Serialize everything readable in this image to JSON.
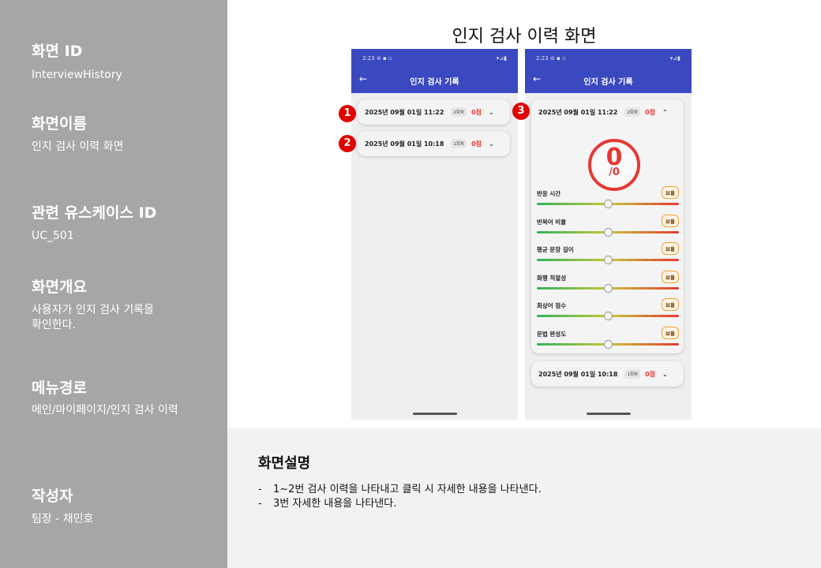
{
  "sidebar": {
    "screen_id_title": "화면 ID",
    "screen_id": "InterviewHistory",
    "screen_name_title": "화면이름",
    "screen_name": "인지 검사 이력 화면",
    "usecase_title": "관련 유스케이스 ID",
    "usecase_id": "UC_501",
    "overview_title": "화면개요",
    "overview_line1": "사용자가  인지 검사 기록을",
    "overview_line2": "확인한다.",
    "menu_title": "메뉴경로",
    "menu_path": "메인/마이페이지/인지 검사 이력",
    "author_title": "작성자",
    "author": "팀장 - 채민호"
  },
  "main_title": "인지 검사 이력 화면",
  "phone": {
    "status_time": "2:23",
    "status_icons_left": "⊘ ▪ ▫",
    "status_icons_right": "▾⊿▮",
    "back_icon": "←",
    "app_title": "인지 검사 기록"
  },
  "records": [
    {
      "date": "2025년 09월 01일 11:22",
      "count": "2회차",
      "score": "0점",
      "chevron": "⌄"
    },
    {
      "date": "2025년 09월 01일 10:18",
      "count": "1회차",
      "score": "0점",
      "chevron": "⌄"
    }
  ],
  "expanded": {
    "chevron_up": "⌃",
    "score_big": "0",
    "score_small": "/0",
    "metrics": [
      {
        "label": "반응 시간",
        "tag": "보통",
        "level": 0.5
      },
      {
        "label": "반복어 비율",
        "tag": "보통",
        "level": 0.5
      },
      {
        "label": "평균 문장 길이",
        "tag": "보통",
        "level": 0.5
      },
      {
        "label": "화행 적절성",
        "tag": "보통",
        "level": 0.5
      },
      {
        "label": "회상어 점수",
        "tag": "보통",
        "level": 0.5
      },
      {
        "label": "문법 완성도",
        "tag": "보통",
        "level": 0.5
      }
    ]
  },
  "badges": [
    "1",
    "2",
    "3"
  ],
  "description": {
    "title": "화면설명",
    "items": [
      "1~2번 검사 이력을 나타내고 클릭 시 자세한 내용을 나타낸다.",
      "3번 자세한 내용을 나타낸다."
    ],
    "bullet": "-"
  },
  "colors": {
    "sidebar_bg": "#a6a6a6",
    "appbar_bg": "#3b49c0",
    "score_red": "#e53935",
    "badge_red": "#e00000"
  }
}
